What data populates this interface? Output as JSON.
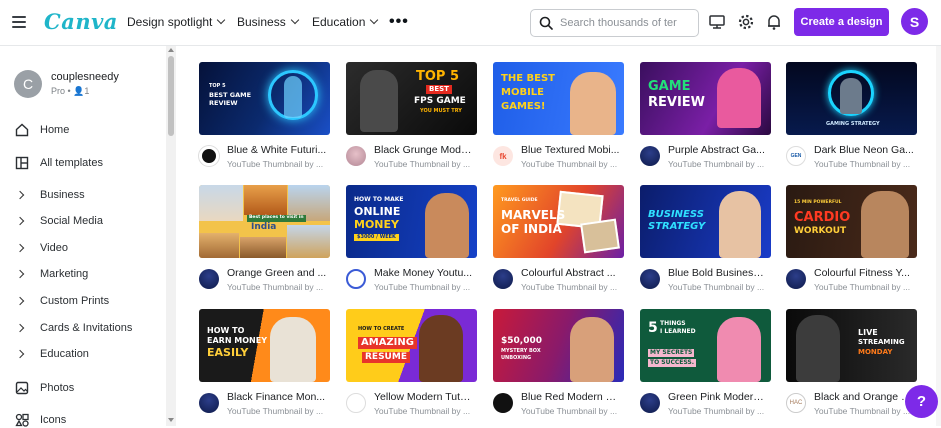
{
  "header": {
    "logo": "Canva",
    "nav": [
      {
        "label": "Design spotlight"
      },
      {
        "label": "Business"
      },
      {
        "label": "Education"
      }
    ],
    "more_icon": "more-horizontal-icon",
    "search": {
      "placeholder": "Search thousands of ter",
      "value": ""
    },
    "icons": [
      "present-icon",
      "gear-icon",
      "bell-icon"
    ],
    "create_button": "Create a design",
    "avatar_initial": "S"
  },
  "sidebar": {
    "profile": {
      "initial": "C",
      "name": "couplesneedy",
      "plan": "Pro",
      "members": "1"
    },
    "items": [
      {
        "label": "Home",
        "icon": "home-icon"
      },
      {
        "label": "All templates",
        "icon": "templates-icon"
      },
      {
        "label": "Business",
        "icon": "chevron-right-icon"
      },
      {
        "label": "Social Media",
        "icon": "chevron-right-icon"
      },
      {
        "label": "Video",
        "icon": "chevron-right-icon"
      },
      {
        "label": "Marketing",
        "icon": "chevron-right-icon"
      },
      {
        "label": "Custom Prints",
        "icon": "chevron-right-icon"
      },
      {
        "label": "Cards & Invitations",
        "icon": "chevron-right-icon"
      },
      {
        "label": "Education",
        "icon": "chevron-right-icon"
      },
      {
        "label": "Photos",
        "icon": "photos-icon"
      },
      {
        "label": "Icons",
        "icon": "shapes-icon"
      }
    ]
  },
  "templates": [
    {
      "title": "Blue & White Futuri...",
      "subtitle": "YouTube Thumbnail by ...",
      "thumb_text": [
        "TOP 5",
        "BEST GAME",
        "REVIEW"
      ]
    },
    {
      "title": "Black Grunge Mode...",
      "subtitle": "YouTube Thumbnail by ...",
      "thumb_text": [
        "TOP 5",
        "BEST",
        "FPS GAME",
        "YOU MUST TRY"
      ]
    },
    {
      "title": "Blue Textured Mobi...",
      "subtitle": "YouTube Thumbnail by ...",
      "thumb_text": [
        "THE BEST",
        "MOBILE",
        "GAMES!"
      ]
    },
    {
      "title": "Purple Abstract Ga...",
      "subtitle": "YouTube Thumbnail by ...",
      "thumb_text": [
        "GAME",
        "REVIEW"
      ]
    },
    {
      "title": "Dark Blue Neon Ga...",
      "subtitle": "YouTube Thumbnail by ...",
      "thumb_text": [
        "GAMING STRATEGY"
      ]
    },
    {
      "title": "Orange Green and ...",
      "subtitle": "YouTube Thumbnail by ...",
      "thumb_text": [
        "Best places to visit in",
        "India"
      ]
    },
    {
      "title": "Make Money Youtu...",
      "subtitle": "YouTube Thumbnail by ...",
      "thumb_text": [
        "HOW TO MAKE",
        "ONLINE",
        "MONEY",
        "$3000 / WEEK"
      ]
    },
    {
      "title": "Colourful Abstract ...",
      "subtitle": "YouTube Thumbnail by ...",
      "thumb_text": [
        "TRAVEL GUIDE",
        "MARVELS",
        "OF INDIA"
      ]
    },
    {
      "title": "Blue Bold Business ...",
      "subtitle": "YouTube Thumbnail by ...",
      "thumb_text": [
        "BUSINESS",
        "STRATEGY"
      ]
    },
    {
      "title": "Colourful Fitness Y...",
      "subtitle": "YouTube Thumbnail by ...",
      "thumb_text": [
        "15 MIN POWERFUL",
        "CARDIO",
        "WORKOUT"
      ]
    },
    {
      "title": "Black Finance Mon...",
      "subtitle": "YouTube Thumbnail by ...",
      "thumb_text": [
        "HOW TO",
        "EARN MONEY",
        "EASILY"
      ]
    },
    {
      "title": "Yellow Modern Tuto...",
      "subtitle": "YouTube Thumbnail by ...",
      "thumb_text": [
        "HOW TO CREATE",
        "AMAZING",
        "RESUME"
      ]
    },
    {
      "title": "Blue Red Modern U...",
      "subtitle": "YouTube Thumbnail by ...",
      "thumb_text": [
        "$50,000",
        "MYSTERY BOX",
        "UNBOXING"
      ]
    },
    {
      "title": "Green Pink Modern ...",
      "subtitle": "YouTube Thumbnail by ...",
      "thumb_text": [
        "5",
        "THINGS",
        "I LEARNED",
        "MY SECRETS",
        "TO SUCCESS."
      ]
    },
    {
      "title": "Black and Orange Li...",
      "subtitle": "YouTube Thumbnail by ...",
      "thumb_text": [
        "LIVE",
        "STREAMING",
        "MONDAY"
      ]
    }
  ],
  "help_button": "?",
  "colors": {
    "brand_purple": "#7d2ae8",
    "logo_teal": "#1fb5c9"
  }
}
